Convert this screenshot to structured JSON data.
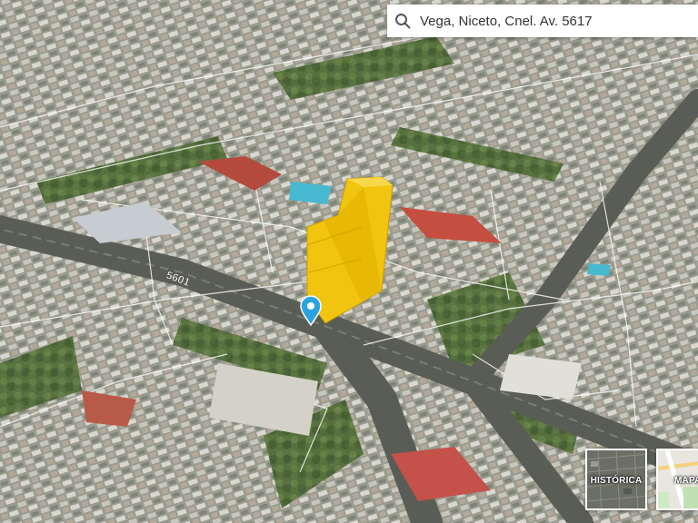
{
  "search": {
    "value": "Vega, Niceto, Cnel. Av. 5617",
    "icon": "search-icon"
  },
  "map": {
    "street_label": "5601",
    "building_color": "#f2c200",
    "pin_color": "#2aa3e0"
  },
  "layers": [
    {
      "label": "HISTÓRICA"
    },
    {
      "label": "MAPA"
    }
  ]
}
